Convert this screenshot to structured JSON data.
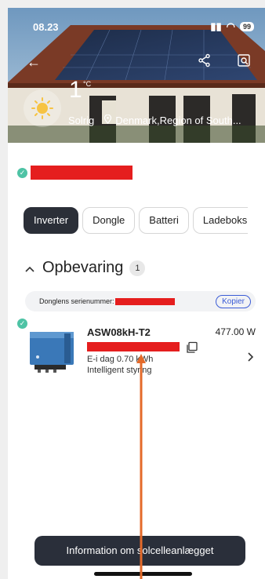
{
  "status_bar": {
    "time": "08.23",
    "battery": "99"
  },
  "weather": {
    "temperature": "1",
    "unit": "°C",
    "condition": "Solrig",
    "location": "Denmark,Region of South..."
  },
  "tabs": [
    {
      "label": "Inverter",
      "active": true
    },
    {
      "label": "Dongle",
      "active": false
    },
    {
      "label": "Batteri",
      "active": false
    },
    {
      "label": "Ladeboks",
      "active": false
    }
  ],
  "group": {
    "title": "Opbevaring",
    "count": "1"
  },
  "serial": {
    "label": "Donglens serienummer:",
    "copy_label": "Kopier"
  },
  "device": {
    "model": "ASW08kH-T2",
    "power": "477.00 W",
    "e_today": "E-i dag  0.70 kWh",
    "mode": "Intelligent styring"
  },
  "info_button": "Information om solcelleanlægget",
  "colors": {
    "accent": "#4ec3a5",
    "dark": "#2b2f38",
    "redaction": "#e51e1e",
    "link": "#3a5bd6"
  }
}
